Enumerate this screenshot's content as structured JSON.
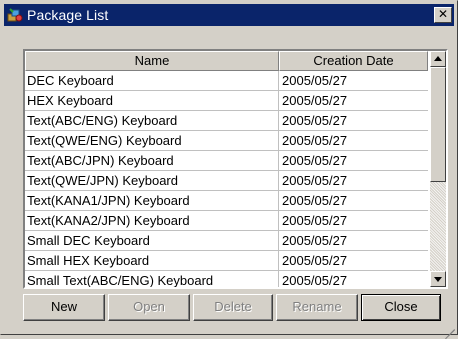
{
  "window": {
    "title": "Package List",
    "titlebar_color": "#0a246a",
    "app_icon": "package-icon",
    "close_glyph": "✕"
  },
  "list": {
    "columns": [
      "Name",
      "Creation Date"
    ],
    "rows": [
      {
        "name": "DEC Keyboard",
        "date": "2005/05/27"
      },
      {
        "name": "HEX Keyboard",
        "date": "2005/05/27"
      },
      {
        "name": "Text(ABC/ENG) Keyboard",
        "date": "2005/05/27"
      },
      {
        "name": "Text(QWE/ENG) Keyboard",
        "date": "2005/05/27"
      },
      {
        "name": "Text(ABC/JPN) Keyboard",
        "date": "2005/05/27"
      },
      {
        "name": "Text(QWE/JPN) Keyboard",
        "date": "2005/05/27"
      },
      {
        "name": "Text(KANA1/JPN) Keyboard",
        "date": "2005/05/27"
      },
      {
        "name": "Text(KANA2/JPN) Keyboard",
        "date": "2005/05/27"
      },
      {
        "name": "Small DEC Keyboard",
        "date": "2005/05/27"
      },
      {
        "name": "Small HEX Keyboard",
        "date": "2005/05/27"
      },
      {
        "name": "Small Text(ABC/ENG) Keyboard",
        "date": "2005/05/27"
      }
    ]
  },
  "buttons": {
    "new": "New",
    "open": "Open",
    "delete": "Delete",
    "rename": "Rename",
    "close": "Close"
  }
}
